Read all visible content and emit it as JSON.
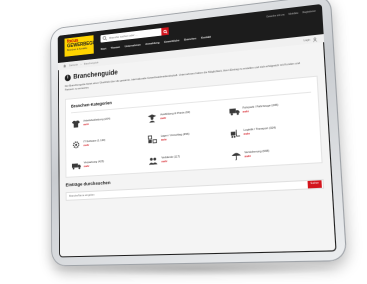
{
  "header": {
    "logo": {
      "line1": "focus",
      "line2": "GEWERBEGUIDE",
      "line3": "Branchen & Kontakte"
    },
    "search_placeholder": "Branche suchen oder ...",
    "nav": [
      "Start",
      "Themen",
      "Unternehmen",
      "Anmeldung",
      "Gewerbliche",
      "Branchen",
      "Kontakt"
    ],
    "top_links": [
      "Gewerbe mit uns",
      "Merkliste",
      "Registrieren"
    ]
  },
  "breadcrumb": [
    "Startseite",
    "Branchenguide"
  ],
  "login_hint": "Login",
  "page": {
    "title": "Branchenguide",
    "intro": "Der Branchenguide bietet einen Überblick über die gesamte, internationale Gewerbeadresslandschaft. Unternehmen haben die Möglichkeit, ihren Eintrag zu erstellen und sich erfolgreich mit Kunden und Partnern zu vernetzen."
  },
  "categories": {
    "title": "Branchen-Kategorien",
    "items": [
      {
        "name": "Arbeitsbekleidung (204)",
        "link": "mehr",
        "icon": "tshirt-icon"
      },
      {
        "name": "Ausbildung & Praxis (62)",
        "link": "mehr",
        "icon": "graduate-icon"
      },
      {
        "name": "Fuhrpark / Fahrzeuge (245)",
        "link": "mehr",
        "icon": "truck-icon"
      },
      {
        "name": "IT-Software (1.120)",
        "link": "mehr",
        "icon": "gear-icon"
      },
      {
        "name": "Lager / Umschlag (456)",
        "link": "mehr",
        "icon": "boxes-icon"
      },
      {
        "name": "Logistik / Transport (324)",
        "link": "mehr",
        "icon": "forklift-icon"
      },
      {
        "name": "Verpackung (425)",
        "link": "mehr",
        "icon": "package-truck-icon"
      },
      {
        "name": "Verbände (117)",
        "link": "mehr",
        "icon": "people-icon"
      },
      {
        "name": "Versicherung (648)",
        "link": "mehr",
        "icon": "umbrella-icon"
      }
    ]
  },
  "search_section": {
    "title": "Einträge durchsuchen",
    "placeholder": "Branche/Name eingeben",
    "button": "Suchen"
  },
  "colors": {
    "brand_red": "#d3151d",
    "brand_yellow": "#ffd400",
    "header_dark": "#1c1c1c"
  }
}
